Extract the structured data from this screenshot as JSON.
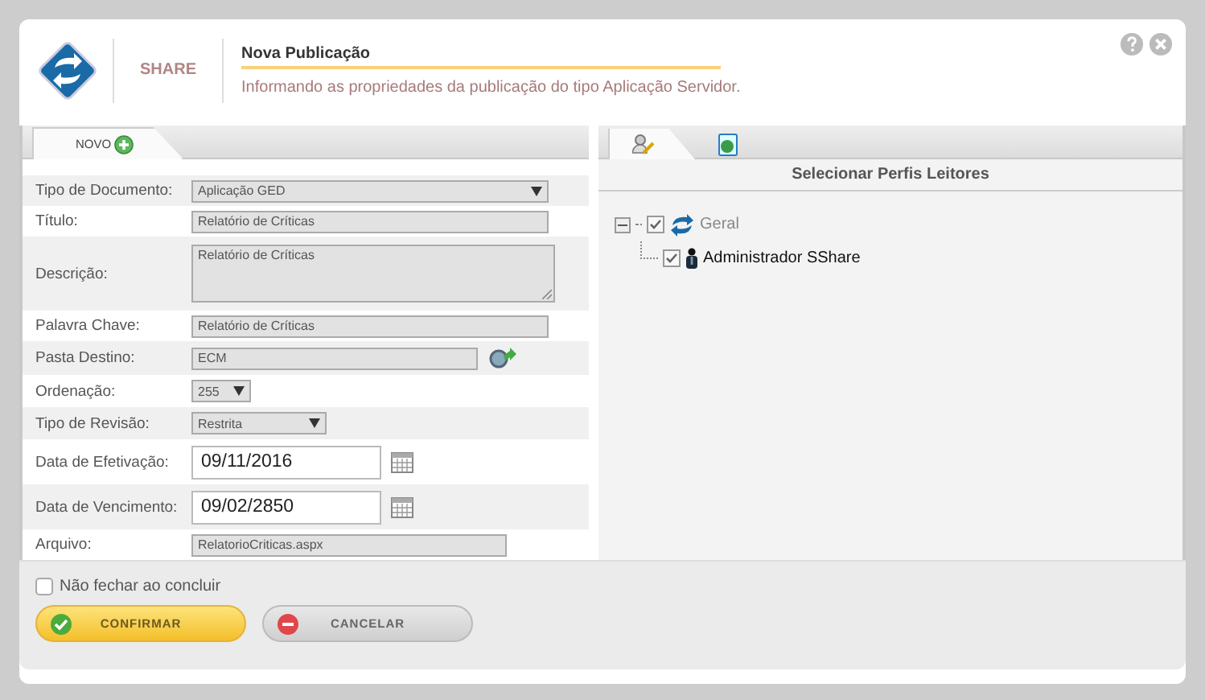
{
  "header": {
    "brand": "SHARE",
    "title": "Nova Publicação",
    "subtitle": "Informando as propriedades da publicação do tipo Aplicação Servidor."
  },
  "left_tabs": [
    {
      "label": "NOVO",
      "selected": true
    }
  ],
  "fields": [
    {
      "label": "Tipo de Documento:",
      "kind": "select",
      "value": "Aplicação GED"
    },
    {
      "label": "Título:",
      "kind": "text",
      "value": "Relatório de Críticas"
    },
    {
      "label": "Descrição:",
      "kind": "textarea",
      "value": "Relatório de Críticas"
    },
    {
      "label": "Palavra Chave:",
      "kind": "text",
      "value": "Relatório de Críticas"
    },
    {
      "label": "Pasta Destino:",
      "kind": "folder",
      "value": "ECM"
    },
    {
      "label": "Ordenação:",
      "kind": "small-select",
      "value": "255"
    },
    {
      "label": "Tipo de Revisão:",
      "kind": "mid-select",
      "value": "Restrita"
    },
    {
      "label": "Data de Efetivação:",
      "kind": "date",
      "value": "09/11/2016"
    },
    {
      "label": "Data de Vencimento:",
      "kind": "date",
      "value": "09/02/2850"
    },
    {
      "label": "Arquivo:",
      "kind": "file",
      "value": "RelatorioCriticas.aspx"
    }
  ],
  "options": [
    {
      "label": "Não fechar ao concluir",
      "checked": false
    }
  ],
  "buttons": [
    {
      "label": "CONFIRMAR",
      "kind": "confirm"
    },
    {
      "label": "CANCELAR",
      "kind": "cancel"
    }
  ],
  "right_tabs": [
    {
      "kind": "users",
      "selected": true
    },
    {
      "kind": "document",
      "selected": false
    }
  ],
  "readers": {
    "title": "Selecionar Perfis Leitores",
    "tree": [
      {
        "label": "Geral",
        "kind": "group",
        "checked": true,
        "expanded": true,
        "children": [
          {
            "label": "Administrador SShare",
            "kind": "user",
            "checked": true
          }
        ]
      }
    ]
  }
}
